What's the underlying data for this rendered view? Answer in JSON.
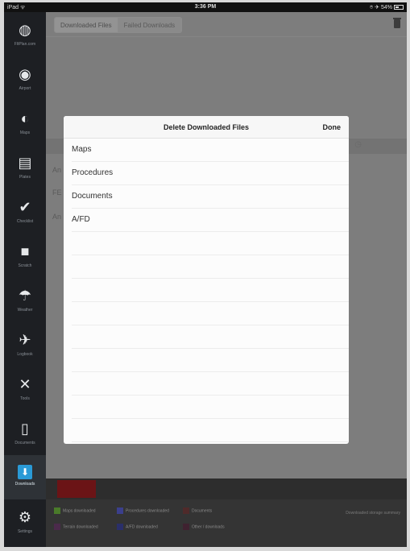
{
  "status_bar": {
    "carrier": "iPad ᯤ",
    "time": "3:36 PM",
    "battery": "⌾ ✈ 54%"
  },
  "sidebar": {
    "items": [
      {
        "label": "FltPlan.com",
        "icon": "globe-icon"
      },
      {
        "label": "Airport",
        "icon": "compass-icon"
      },
      {
        "label": "Maps",
        "icon": "map-icon"
      },
      {
        "label": "Plates",
        "icon": "plate-icon"
      },
      {
        "label": "Checklist",
        "icon": "checkmark-icon"
      },
      {
        "label": "Scratch",
        "icon": "scratchpad-icon"
      },
      {
        "label": "Weather",
        "icon": "weather-icon"
      },
      {
        "label": "Logbook",
        "icon": "airplane-icon"
      },
      {
        "label": "Tools",
        "icon": "tools-icon"
      },
      {
        "label": "Documents",
        "icon": "document-icon"
      },
      {
        "label": "Downloads",
        "icon": "download-icon"
      },
      {
        "label": "Settings",
        "icon": "gear-icon"
      }
    ]
  },
  "main": {
    "tabs": [
      {
        "label": "Downloaded Files",
        "selected": true
      },
      {
        "label": "Failed Downloads",
        "selected": false
      }
    ],
    "background_rows": [
      "An",
      "FE",
      "An"
    ],
    "sort_glyph": "◷"
  },
  "modal": {
    "title": "Delete Downloaded Files",
    "done_label": "Done",
    "items": [
      "Maps",
      "Procedures",
      "Documents",
      "A/FD"
    ]
  },
  "legend": {
    "items": [
      {
        "label": "Maps downloaded",
        "color": "#4a7a2a"
      },
      {
        "label": "Procedures downloaded",
        "color": "#3b3f8c"
      },
      {
        "label": "Documents",
        "color": "#4f2a2a"
      },
      {
        "label": "Terrain downloaded",
        "color": "#4b2a4b"
      },
      {
        "label": "A/FD downloaded",
        "color": "#2a2f6a"
      },
      {
        "label": "Other / downloads",
        "color": "#3f2230"
      }
    ],
    "note": "Downloaded storage summary"
  }
}
